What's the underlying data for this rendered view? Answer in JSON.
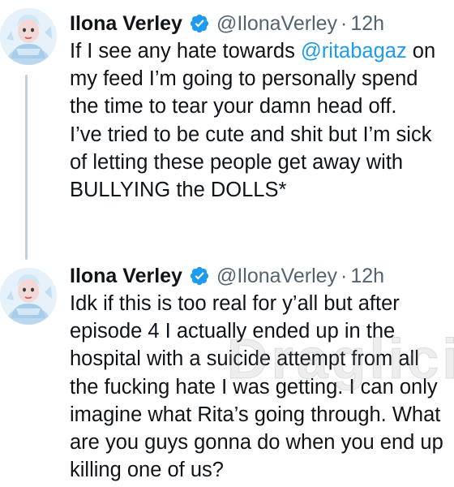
{
  "tweets": [
    {
      "display_name": "Ilona Verley",
      "handle": "@IlonaVerley",
      "separator": "·",
      "time": "12h",
      "lines": [
        [
          "If I see any hate towards ",
          "@ritabagaz",
          " on"
        ],
        [
          "my feed I’m going to personally spend",
          "",
          ""
        ],
        [
          "the time to tear your damn head off.",
          "",
          ""
        ],
        [
          "I’ve tried to be cute and shit but I’m sick",
          "",
          ""
        ],
        [
          "of letting these people get away with",
          "",
          ""
        ],
        [
          "BULLYING the DOLLS*",
          "",
          ""
        ]
      ]
    },
    {
      "display_name": "Ilona Verley",
      "handle": "@IlonaVerley",
      "separator": "·",
      "time": "12h",
      "lines": [
        [
          "Idk if this is too real for y’all but after"
        ],
        [
          "episode 4 I actually ended up in the"
        ],
        [
          "hospital with a suicide attempt from all"
        ],
        [
          "the fucking hate I was getting. I can only"
        ],
        [
          "imagine what Rita’s going through. What"
        ],
        [
          "are you guys gonna do when you end up"
        ],
        [
          "killing one of us?"
        ]
      ]
    }
  ],
  "watermark": {
    "part_a": "Drag",
    "part_b": "licious"
  },
  "icons": {
    "verified": "verified-badge-icon",
    "avatar": "profile-avatar"
  },
  "colors": {
    "verified": "#1d9bf0",
    "mention": "#1d9bf0",
    "meta": "#536471",
    "text": "#0f1419",
    "thread_line": "#c4cfd6"
  }
}
